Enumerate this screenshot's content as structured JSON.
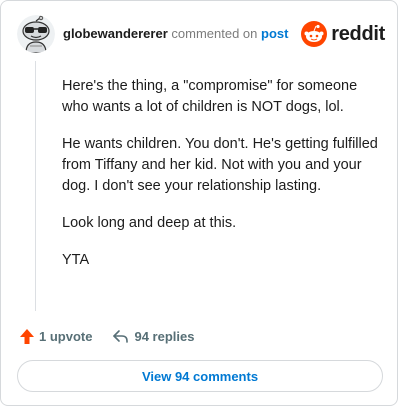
{
  "header": {
    "username": "globewandererer",
    "action_text": "commented on",
    "post_link": "post",
    "brand": "reddit"
  },
  "comment": {
    "paragraphs": [
      "Here's the thing, a \"compromise\" for someone who wants a lot of children is NOT dogs, lol.",
      "He wants children. You don't. He's getting fulfilled from Tiffany and her kid. Not with you and your dog. I don't see your relationship lasting.",
      "Look long and deep at this.",
      "YTA"
    ]
  },
  "actions": {
    "upvote_label": "1 upvote",
    "replies_label": "94 replies"
  },
  "footer": {
    "view_button": "View 94 comments"
  },
  "colors": {
    "brand_orange": "#ff4500",
    "link_blue": "#0079d3",
    "text": "#1c1c1c",
    "muted": "#576f76"
  },
  "icons": {
    "avatar": "snoo-avatar-with-sunglasses",
    "logo": "reddit-snoo-icon",
    "upvote": "upvote-arrow-icon",
    "reply": "reply-arrow-icon"
  }
}
